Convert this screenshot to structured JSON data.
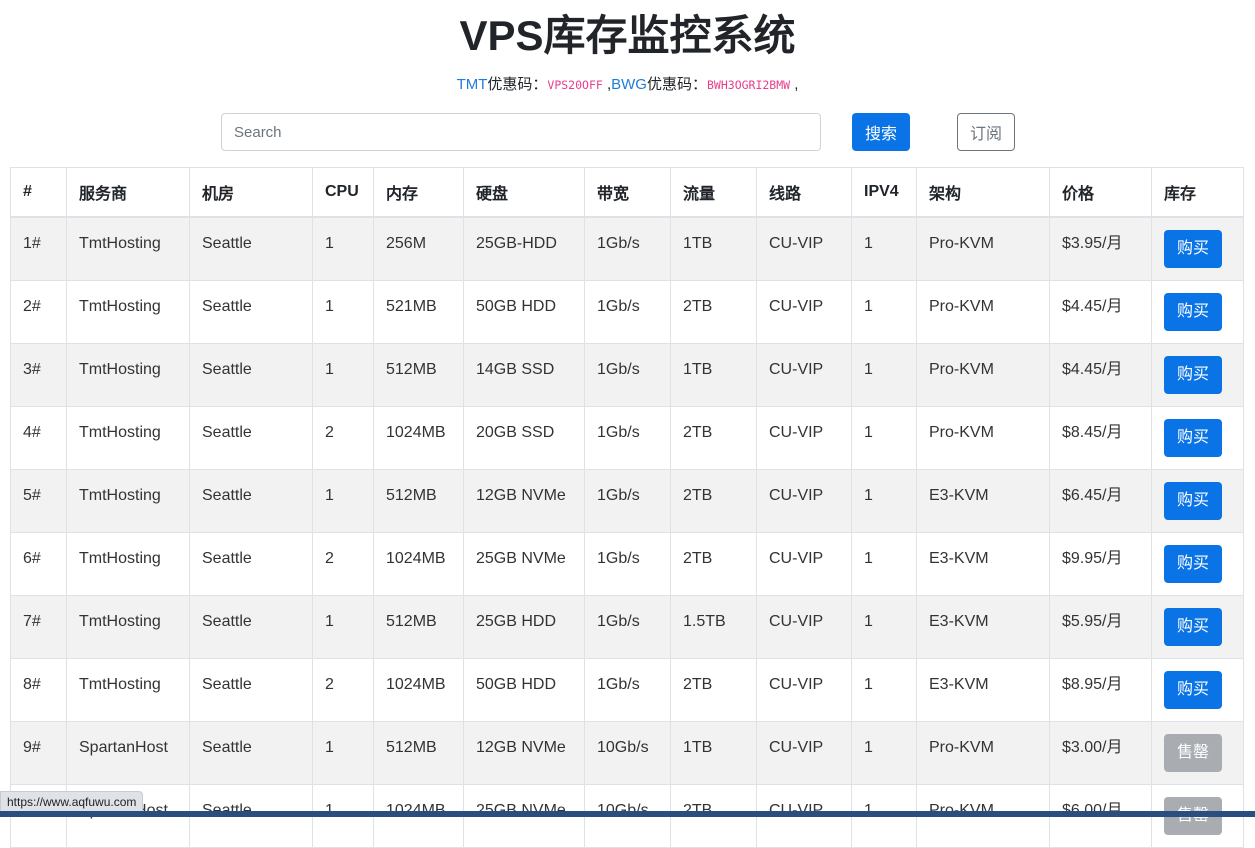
{
  "page": {
    "title": "VPS库存监控系统",
    "promo": {
      "tmt_label": "TMT",
      "tmt_suffix": "优惠码：",
      "tmt_code": "VPS20OFF",
      "sep": " ,",
      "bwg_label": "BWG",
      "bwg_suffix": "优惠码：",
      "bwg_code": "BWH3OGRI2BMW",
      "tail": " ,"
    }
  },
  "search": {
    "placeholder": "Search",
    "button": "搜索",
    "subscribe": "订阅"
  },
  "table": {
    "headers": [
      "#",
      "服务商",
      "机房",
      "CPU",
      "内存",
      "硬盘",
      "带宽",
      "流量",
      "线路",
      "IPV4",
      "架构",
      "价格",
      "库存"
    ],
    "rows": [
      {
        "id": "1#",
        "provider": "TmtHosting",
        "dc": "Seattle",
        "cpu": "1",
        "ram": "256M",
        "disk": "25GB-HDD",
        "bw": "1Gb/s",
        "traffic": "1TB",
        "line": "CU-VIP",
        "ipv4": "1",
        "arch": "Pro-KVM",
        "price": "$3.95/月",
        "stock": "购买",
        "status": "available"
      },
      {
        "id": "2#",
        "provider": "TmtHosting",
        "dc": "Seattle",
        "cpu": "1",
        "ram": "521MB",
        "disk": "50GB HDD",
        "bw": "1Gb/s",
        "traffic": "2TB",
        "line": "CU-VIP",
        "ipv4": "1",
        "arch": "Pro-KVM",
        "price": "$4.45/月",
        "stock": "购买",
        "status": "available"
      },
      {
        "id": "3#",
        "provider": "TmtHosting",
        "dc": "Seattle",
        "cpu": "1",
        "ram": "512MB",
        "disk": "14GB SSD",
        "bw": "1Gb/s",
        "traffic": "1TB",
        "line": "CU-VIP",
        "ipv4": "1",
        "arch": "Pro-KVM",
        "price": "$4.45/月",
        "stock": "购买",
        "status": "available"
      },
      {
        "id": "4#",
        "provider": "TmtHosting",
        "dc": "Seattle",
        "cpu": "2",
        "ram": "1024MB",
        "disk": "20GB SSD",
        "bw": "1Gb/s",
        "traffic": "2TB",
        "line": "CU-VIP",
        "ipv4": "1",
        "arch": "Pro-KVM",
        "price": "$8.45/月",
        "stock": "购买",
        "status": "available"
      },
      {
        "id": "5#",
        "provider": "TmtHosting",
        "dc": "Seattle",
        "cpu": "1",
        "ram": "512MB",
        "disk": "12GB NVMe",
        "bw": "1Gb/s",
        "traffic": "2TB",
        "line": "CU-VIP",
        "ipv4": "1",
        "arch": "E3-KVM",
        "price": "$6.45/月",
        "stock": "购买",
        "status": "available"
      },
      {
        "id": "6#",
        "provider": "TmtHosting",
        "dc": "Seattle",
        "cpu": "2",
        "ram": "1024MB",
        "disk": "25GB NVMe",
        "bw": "1Gb/s",
        "traffic": "2TB",
        "line": "CU-VIP",
        "ipv4": "1",
        "arch": "E3-KVM",
        "price": "$9.95/月",
        "stock": "购买",
        "status": "available"
      },
      {
        "id": "7#",
        "provider": "TmtHosting",
        "dc": "Seattle",
        "cpu": "1",
        "ram": "512MB",
        "disk": "25GB HDD",
        "bw": "1Gb/s",
        "traffic": "1.5TB",
        "line": "CU-VIP",
        "ipv4": "1",
        "arch": "E3-KVM",
        "price": "$5.95/月",
        "stock": "购买",
        "status": "available"
      },
      {
        "id": "8#",
        "provider": "TmtHosting",
        "dc": "Seattle",
        "cpu": "2",
        "ram": "1024MB",
        "disk": "50GB HDD",
        "bw": "1Gb/s",
        "traffic": "2TB",
        "line": "CU-VIP",
        "ipv4": "1",
        "arch": "E3-KVM",
        "price": "$8.95/月",
        "stock": "购买",
        "status": "available"
      },
      {
        "id": "9#",
        "provider": "SpartanHost",
        "dc": "Seattle",
        "cpu": "1",
        "ram": "512MB",
        "disk": "12GB NVMe",
        "bw": "10Gb/s",
        "traffic": "1TB",
        "line": "CU-VIP",
        "ipv4": "1",
        "arch": "Pro-KVM",
        "price": "$3.00/月",
        "stock": "售罄",
        "status": "sold-out"
      },
      {
        "id": "10#",
        "provider": "SpartanHost",
        "dc": "Seattle",
        "cpu": "1",
        "ram": "1024MB",
        "disk": "25GB NVMe",
        "bw": "10Gb/s",
        "traffic": "2TB",
        "line": "CU-VIP",
        "ipv4": "1",
        "arch": "Pro-KVM",
        "price": "$6.00/月",
        "stock": "售罄",
        "status": "sold-out"
      }
    ]
  },
  "browser": {
    "status_url": "https://www.aqfuwu.com"
  },
  "colors": {
    "primary": "#0a74e6",
    "sold": "#a9adb2",
    "link": "#1e7ed6",
    "code": "#e83e8c",
    "stripe": "#f2f2f2"
  }
}
